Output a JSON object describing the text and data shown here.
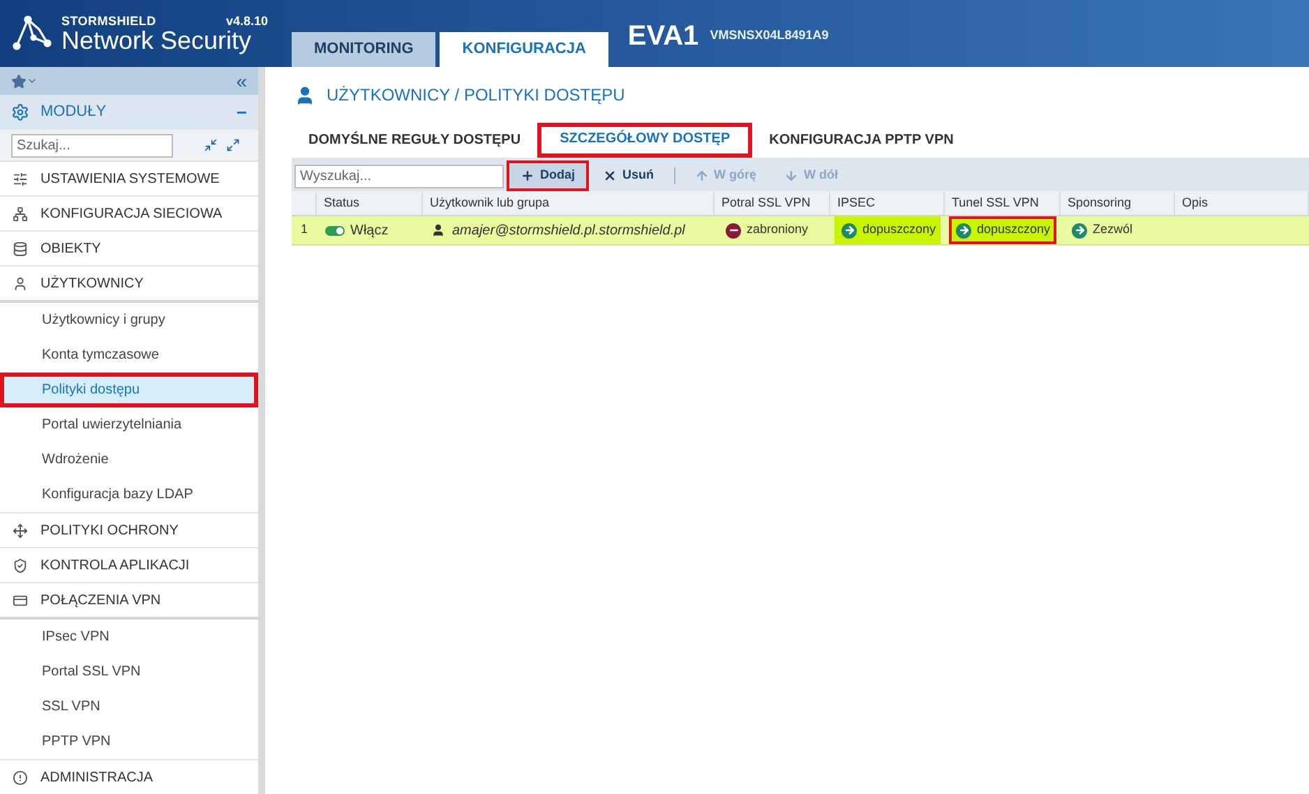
{
  "header": {
    "brand": "STORMSHIELD",
    "product": "Network Security",
    "version": "v4.8.10",
    "tabs": [
      {
        "label": "MONITORING",
        "selected": false
      },
      {
        "label": "KONFIGURACJA",
        "selected": true
      }
    ],
    "device": "EVA1",
    "serial": "VMSNSX04L8491A9"
  },
  "sidebar": {
    "modules_label": "MODUŁY",
    "collapse_glyph": "«",
    "minus_glyph": "−",
    "search": {
      "placeholder": "Szukaj..."
    },
    "items": [
      {
        "label": "USTAWIENIA SYSTEMOWE"
      },
      {
        "label": "KONFIGURACJA SIECIOWA"
      },
      {
        "label": "OBIEKTY"
      },
      {
        "label": "UŻYTKOWNICY",
        "children": [
          {
            "label": "Użytkownicy i grupy",
            "selected": false,
            "highlighted": false
          },
          {
            "label": "Konta tymczasowe",
            "selected": false,
            "highlighted": false
          },
          {
            "label": "Polityki dostępu",
            "selected": true,
            "highlighted": true
          },
          {
            "label": "Portal uwierzytelniania",
            "selected": false,
            "highlighted": false
          },
          {
            "label": "Wdrożenie",
            "selected": false,
            "highlighted": false
          },
          {
            "label": "Konfiguracja bazy LDAP",
            "selected": false,
            "highlighted": false
          }
        ]
      },
      {
        "label": "POLITYKI OCHRONY"
      },
      {
        "label": "KONTROLA APLIKACJI"
      },
      {
        "label": "POŁĄCZENIA VPN",
        "children": [
          {
            "label": "IPsec VPN",
            "selected": false,
            "highlighted": false
          },
          {
            "label": "Portal SSL VPN",
            "selected": false,
            "highlighted": false
          },
          {
            "label": "SSL VPN",
            "selected": false,
            "highlighted": false
          },
          {
            "label": "PPTP VPN",
            "selected": false,
            "highlighted": false
          }
        ]
      },
      {
        "label": "ADMINISTRACJA"
      }
    ]
  },
  "page": {
    "title": "UŻYTKOWNICY / POLITYKI DOSTĘPU",
    "tabs": [
      {
        "label": "DOMYŚLNE REGUŁY DOSTĘPU",
        "selected": false,
        "highlighted": false
      },
      {
        "label": "SZCZEGÓŁOWY DOSTĘP",
        "selected": true,
        "highlighted": true
      },
      {
        "label": "KONFIGURACJA PPTP VPN",
        "selected": false,
        "highlighted": false
      }
    ],
    "search": {
      "placeholder": "Wyszukaj..."
    },
    "toolbar": [
      {
        "kind": "add",
        "label": "Dodaj",
        "disabled": false,
        "highlighted": true
      },
      {
        "kind": "delete",
        "label": "Usuń",
        "disabled": false,
        "highlighted": false
      },
      {
        "kind": "up",
        "label": "W górę",
        "disabled": true,
        "highlighted": false
      },
      {
        "kind": "down",
        "label": "W dół",
        "disabled": true,
        "highlighted": false
      }
    ],
    "table": {
      "columns": [
        "Status",
        "Użytkownik lub grupa",
        "Potral SSL VPN",
        "IPSEC",
        "Tunel SSL VPN",
        "Sponsoring",
        "Opis"
      ],
      "rows": [
        {
          "number": "1",
          "cells": [
            {
              "kind": "status",
              "label": "Włącz",
              "on": true
            },
            {
              "kind": "user",
              "label": "amajer@stormshield.pl.stormshield.pl"
            },
            {
              "kind": "denied",
              "label": "zabroniony",
              "emphasized": false,
              "highlighted": false
            },
            {
              "kind": "allowed",
              "label": "dopuszczony",
              "emphasized": true,
              "highlighted": false
            },
            {
              "kind": "allowed",
              "label": "dopuszczony",
              "emphasized": true,
              "highlighted": true
            },
            {
              "kind": "allowed",
              "label": "Zezwól",
              "emphasized": false,
              "highlighted": false
            }
          ]
        }
      ]
    }
  }
}
